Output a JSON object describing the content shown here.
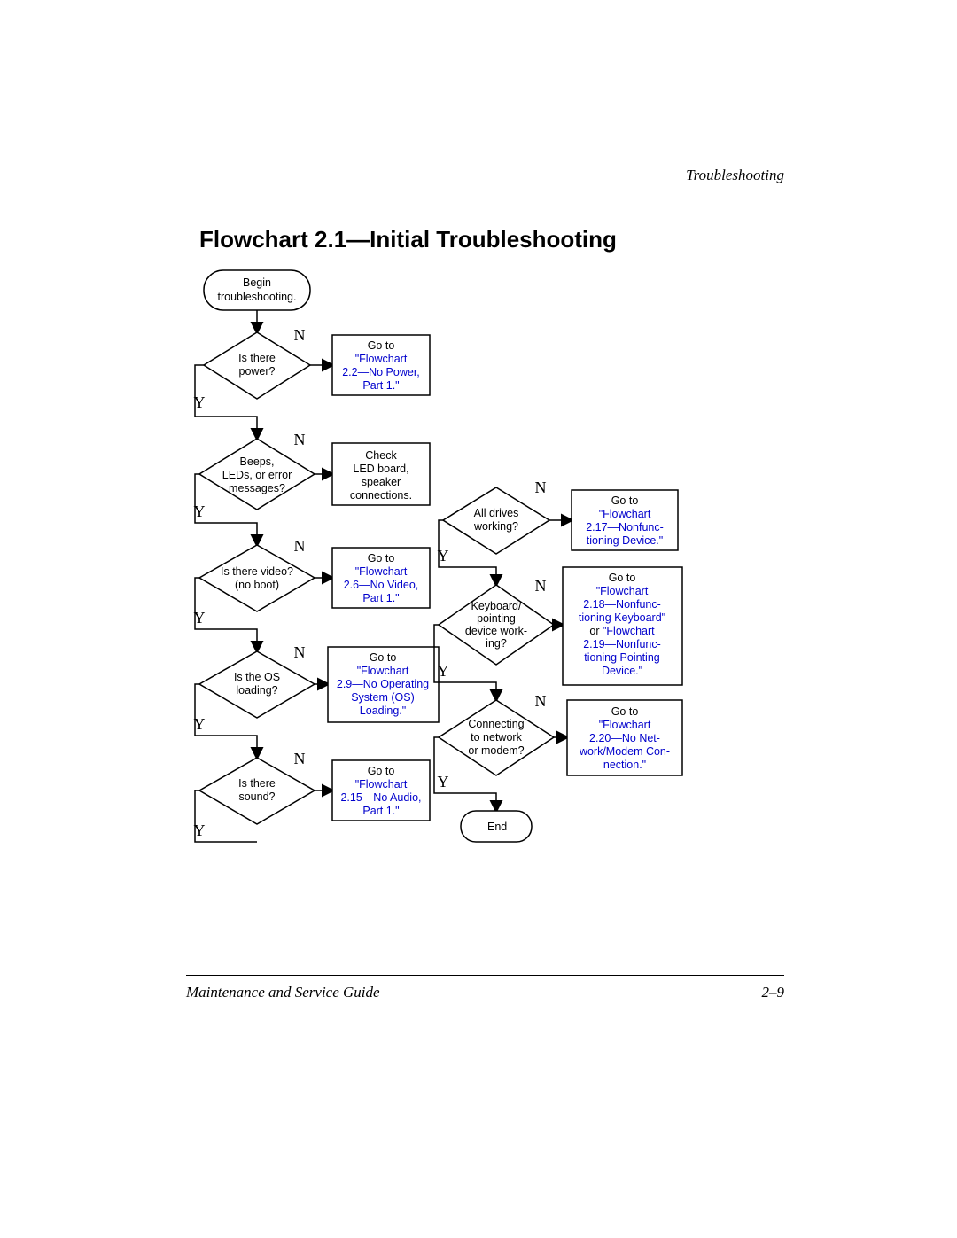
{
  "header": {
    "label": "Troubleshooting"
  },
  "footer": {
    "left": "Maintenance and Service Guide",
    "right": "2–9"
  },
  "title": "Flowchart 2.1—Initial Troubleshooting",
  "labels": {
    "yes": "Y",
    "no": "N"
  },
  "begin": {
    "l1": "Begin",
    "l2": "troubleshooting."
  },
  "end": {
    "l1": "End"
  },
  "d1": {
    "l1": "Is there",
    "l2": "power?"
  },
  "d2": {
    "l1": "Beeps,",
    "l2": "LEDs, or error",
    "l3": "messages?"
  },
  "d3": {
    "l1": "Is there video?",
    "l2": "(no boot)"
  },
  "d4": {
    "l1": "Is the OS",
    "l2": "loading?"
  },
  "d5": {
    "l1": "Is there",
    "l2": "sound?"
  },
  "d6": {
    "l1": "All drives",
    "l2": "working?"
  },
  "d7": {
    "l1": "Keyboard/",
    "l2": "pointing",
    "l3": "device work-",
    "l4": "ing?"
  },
  "d8": {
    "l1": "Connecting",
    "l2": "to network",
    "l3": "or modem?"
  },
  "r1": {
    "pre": "Go to",
    "l1": "\"Flowchart",
    "l2": "2.2—No Power,",
    "l3": "Part 1.\""
  },
  "r2": {
    "l1": "Check",
    "l2": "LED board,",
    "l3": "speaker",
    "l4": "connections."
  },
  "r3": {
    "pre": "Go to",
    "l1": "\"Flowchart",
    "l2": "2.6—No Video,",
    "l3": "Part 1.\""
  },
  "r4": {
    "pre": "Go to",
    "l1": "\"Flowchart",
    "l2": "2.9—No Operating",
    "l3": "System (OS)",
    "l4": "Loading.\""
  },
  "r5": {
    "pre": "Go to",
    "l1": "\"Flowchart",
    "l2": "2.15—No Audio,",
    "l3": "Part 1.\""
  },
  "r6": {
    "pre": "Go to",
    "l1": "\"Flowchart",
    "l2": "2.17—Nonfunc-",
    "l3": "tioning Device.\""
  },
  "r7": {
    "pre": "Go to",
    "l1": "\"Flowchart",
    "l2": "2.18—Nonfunc-",
    "l3": "tioning Keyboard\"",
    "mid": "or",
    "l4": "\"Flowchart",
    "l5": "2.19—Nonfunc-",
    "l6": "tioning Pointing",
    "l7": "Device.\""
  },
  "r8": {
    "pre": "Go to",
    "l1": "\"Flowchart",
    "l2": "2.20—No Net-",
    "l3": "work/Modem Con-",
    "l4": "nection.\""
  },
  "chart_data": {
    "type": "flowchart",
    "title": "Flowchart 2.1—Initial Troubleshooting",
    "nodes": [
      {
        "id": "begin",
        "shape": "terminator",
        "text": "Begin troubleshooting."
      },
      {
        "id": "d1",
        "shape": "decision",
        "text": "Is there power?"
      },
      {
        "id": "r1",
        "shape": "process",
        "text": "Go to \"Flowchart 2.2—No Power, Part 1.\""
      },
      {
        "id": "d2",
        "shape": "decision",
        "text": "Beeps, LEDs, or error messages?"
      },
      {
        "id": "r2",
        "shape": "process",
        "text": "Check LED board, speaker connections."
      },
      {
        "id": "d3",
        "shape": "decision",
        "text": "Is there video? (no boot)"
      },
      {
        "id": "r3",
        "shape": "process",
        "text": "Go to \"Flowchart 2.6—No Video, Part 1.\""
      },
      {
        "id": "d4",
        "shape": "decision",
        "text": "Is the OS loading?"
      },
      {
        "id": "r4",
        "shape": "process",
        "text": "Go to \"Flowchart 2.9—No Operating System (OS) Loading.\""
      },
      {
        "id": "d5",
        "shape": "decision",
        "text": "Is there sound?"
      },
      {
        "id": "r5",
        "shape": "process",
        "text": "Go to \"Flowchart 2.15—No Audio, Part 1.\""
      },
      {
        "id": "d6",
        "shape": "decision",
        "text": "All drives working?"
      },
      {
        "id": "r6",
        "shape": "process",
        "text": "Go to \"Flowchart 2.17—Nonfunctioning Device.\""
      },
      {
        "id": "d7",
        "shape": "decision",
        "text": "Keyboard/pointing device working?"
      },
      {
        "id": "r7",
        "shape": "process",
        "text": "Go to \"Flowchart 2.18—Nonfunctioning Keyboard\" or \"Flowchart 2.19—Nonfunctioning Pointing Device.\""
      },
      {
        "id": "d8",
        "shape": "decision",
        "text": "Connecting to network or modem?"
      },
      {
        "id": "r8",
        "shape": "process",
        "text": "Go to \"Flowchart 2.20—No Network/Modem Connection.\""
      },
      {
        "id": "end",
        "shape": "terminator",
        "text": "End"
      }
    ],
    "edges": [
      {
        "from": "begin",
        "to": "d1"
      },
      {
        "from": "d1",
        "to": "r1",
        "label": "N"
      },
      {
        "from": "d1",
        "to": "d2",
        "label": "Y"
      },
      {
        "from": "d2",
        "to": "r2",
        "label": "N"
      },
      {
        "from": "d2",
        "to": "d3",
        "label": "Y"
      },
      {
        "from": "d3",
        "to": "r3",
        "label": "N"
      },
      {
        "from": "d3",
        "to": "d4",
        "label": "Y"
      },
      {
        "from": "d4",
        "to": "r4",
        "label": "N"
      },
      {
        "from": "d4",
        "to": "d5",
        "label": "Y"
      },
      {
        "from": "d5",
        "to": "r5",
        "label": "N"
      },
      {
        "from": "d5",
        "to": "d6",
        "label": "Y"
      },
      {
        "from": "d6",
        "to": "r6",
        "label": "N"
      },
      {
        "from": "d6",
        "to": "d7",
        "label": "Y"
      },
      {
        "from": "d7",
        "to": "r7",
        "label": "N"
      },
      {
        "from": "d7",
        "to": "d8",
        "label": "Y"
      },
      {
        "from": "d8",
        "to": "r8",
        "label": "N"
      },
      {
        "from": "d8",
        "to": "end",
        "label": "Y"
      }
    ]
  }
}
